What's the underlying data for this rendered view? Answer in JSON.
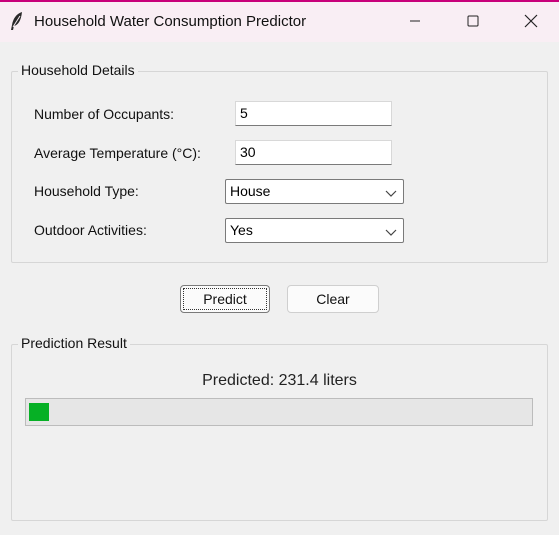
{
  "window": {
    "title": "Household Water Consumption Predictor",
    "accent": "#c8007a",
    "icons": {
      "app": "feather-icon",
      "minimize": "minimize-icon",
      "maximize": "maximize-icon",
      "close": "close-icon"
    }
  },
  "details": {
    "group_label": "Household Details",
    "occupants": {
      "label": "Number of Occupants:",
      "value": "5"
    },
    "temperature": {
      "label": "Average Temperature (°C):",
      "value": "30"
    },
    "household_type": {
      "label": "Household Type:",
      "value": "House"
    },
    "outdoor": {
      "label": "Outdoor Activities:",
      "value": "Yes"
    }
  },
  "actions": {
    "predict_label": "Predict",
    "clear_label": "Clear"
  },
  "result": {
    "group_label": "Prediction Result",
    "text": "Predicted: 231.4 liters",
    "progress_fraction": 0.04,
    "progress_color": "#06b025"
  }
}
